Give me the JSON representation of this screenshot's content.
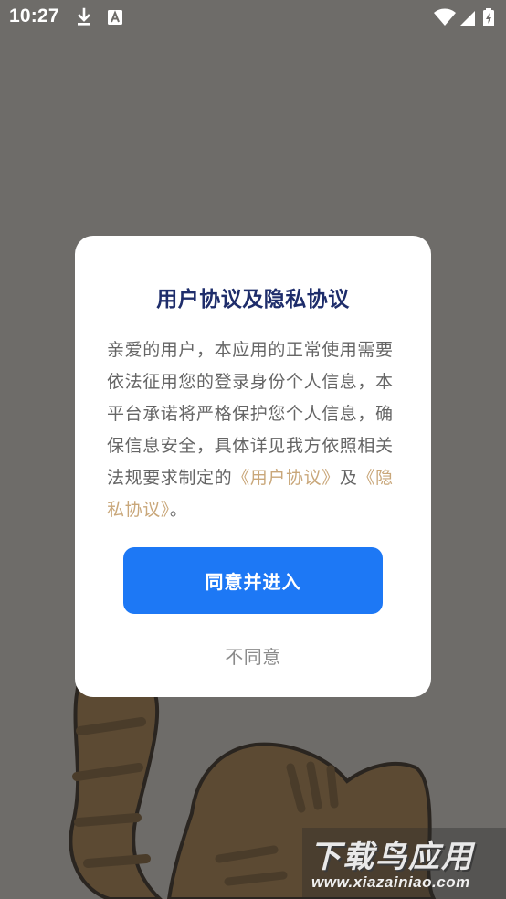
{
  "status_bar": {
    "time": "10:27",
    "icons": [
      "download-icon",
      "a-notification-icon",
      "wifi-icon",
      "cellular-signal-icon",
      "battery-charging-icon"
    ]
  },
  "dialog": {
    "title": "用户协议及隐私协议",
    "body_text": "亲爱的用户，本应用的正常使用需要依法征用您的登录身份个人信息，本平台承诺将严格保护您个人信息，确保信息安全，具体详见我方依照相关法规要求制定的",
    "user_agreement_link": "《用户协议》",
    "conjunction": "及",
    "privacy_agreement_link": "《隐私协议》",
    "ending": "。",
    "agree_button": "同意并进入",
    "disagree_button": "不同意"
  },
  "watermark": {
    "name": "下载鸟应用",
    "url": "www.xiazainiao.com"
  },
  "colors": {
    "overlay_background": "#6e6c69",
    "title": "#1e2d6b",
    "body_text": "#666666",
    "link": "#c9a77a",
    "primary_button": "#1d78f5",
    "secondary_button_text": "#8a8a8a"
  }
}
